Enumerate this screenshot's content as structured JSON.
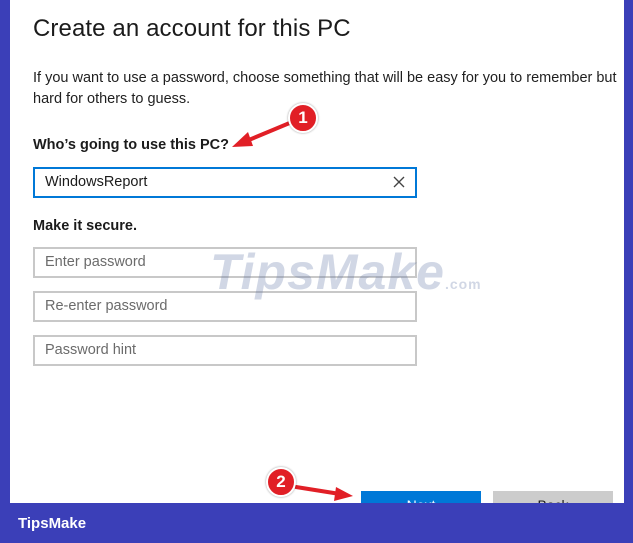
{
  "dialog": {
    "title": "Create an account for this PC",
    "description": "If you want to use a password, choose something that will be easy for you to remember but hard for others to guess.",
    "who_label": "Who’s going to use this PC?",
    "username_value": "WindowsReport",
    "secure_label": "Make it secure.",
    "password_placeholder": "Enter password",
    "reenter_placeholder": "Re-enter password",
    "hint_placeholder": "Password hint",
    "next_label": "Next",
    "back_label": "Back"
  },
  "annotations": {
    "badge1": "1",
    "badge2": "2",
    "color": "#e11f26"
  },
  "watermark": {
    "text": "TipsMake",
    "suffix": ".com"
  },
  "footer": {
    "brand": "TipsMake",
    "background": "#3b3fb8"
  },
  "colors": {
    "accent": "#0078d7",
    "field_border": "#c8c8c8"
  }
}
